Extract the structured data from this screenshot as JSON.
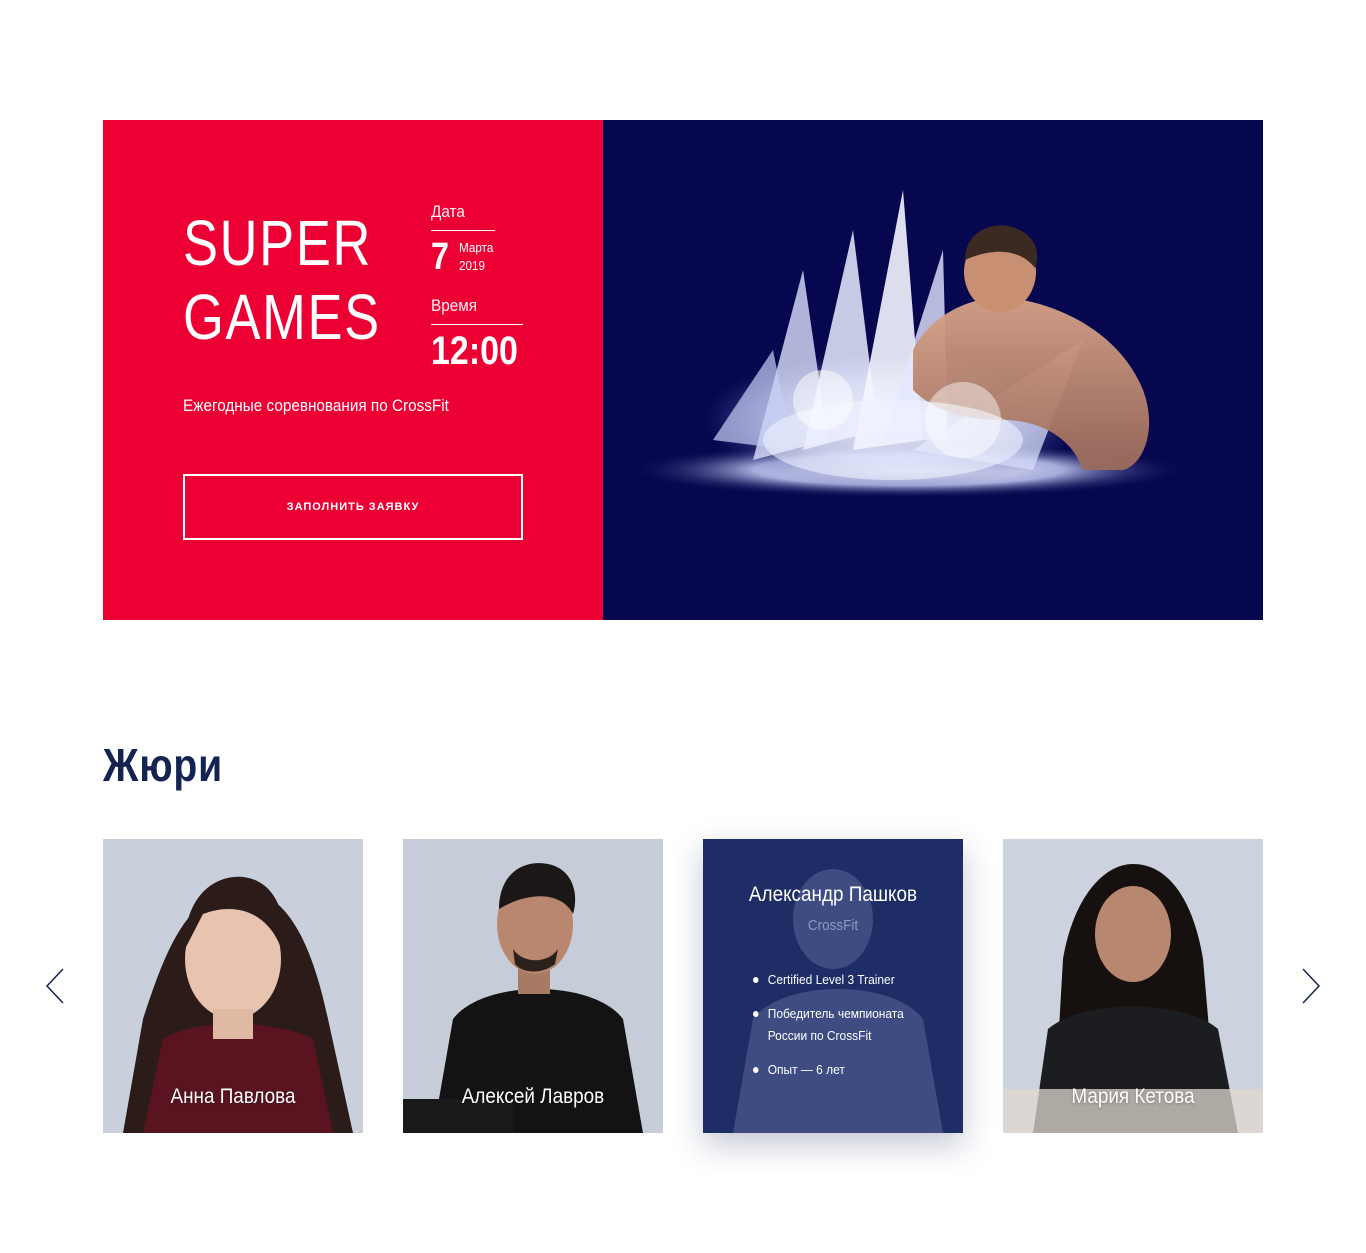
{
  "hero": {
    "title_line1": "SUPER",
    "title_line2": "GAMES",
    "date_label": "Дата",
    "date_day": "7",
    "date_month": "Марта",
    "date_year": "2019",
    "time_label": "Время",
    "time_value": "12:00",
    "subtitle": "Ежегодные соревнования по CrossFit",
    "cta_label": "ЗАПОЛНИТЬ ЗАЯВКУ",
    "colors": {
      "left_bg": "#ec0033",
      "right_bg": "#07074f"
    }
  },
  "jury": {
    "title": "Жюри",
    "members": [
      {
        "name": "Анна Павлова"
      },
      {
        "name": "Алексей Лавров"
      },
      {
        "name": "Александр Пашков",
        "sport": "CrossFit",
        "facts": [
          "Certified Level 3 Trainer",
          "Победитель чемпионата России по CrossFit",
          "Опыт — 6 лет"
        ]
      },
      {
        "name": "Мария Кетова"
      }
    ],
    "prev_icon": "chevron-left-icon",
    "next_icon": "chevron-right-icon"
  }
}
